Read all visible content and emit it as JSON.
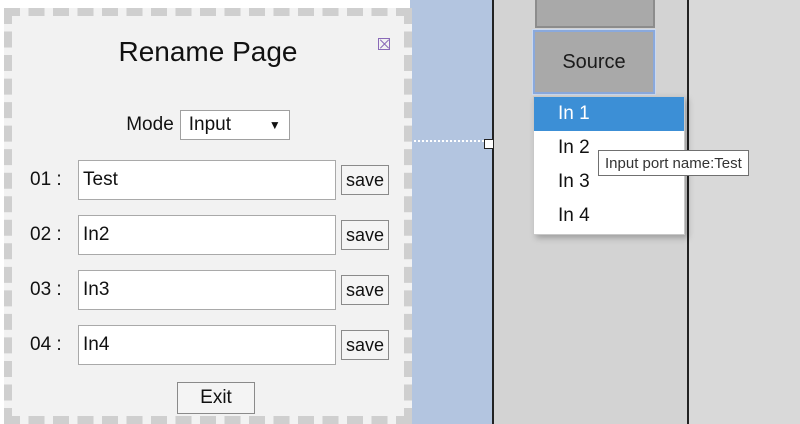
{
  "dialog": {
    "title": "Rename Page",
    "mode_label": "Mode",
    "mode_value": "Input",
    "rows": [
      {
        "label": "01 :",
        "value": "Test",
        "save": "save"
      },
      {
        "label": "02 :",
        "value": "In2",
        "save": "save"
      },
      {
        "label": "03 :",
        "value": "In3",
        "save": "save"
      },
      {
        "label": "04 :",
        "value": "In4",
        "save": "save"
      }
    ],
    "exit_label": "Exit"
  },
  "source_button": "Source",
  "dropdown": {
    "items": [
      "In 1",
      "In 2",
      "In 3",
      "In 4"
    ],
    "selected": "In 1"
  },
  "tooltip": "Input port name:Test",
  "colors": {
    "selected_bg": "#3c8fd6",
    "panel_blue": "#b3c5e0",
    "panel_gray": "#d3d3d3",
    "dialog_bg": "#f2f2f2"
  }
}
